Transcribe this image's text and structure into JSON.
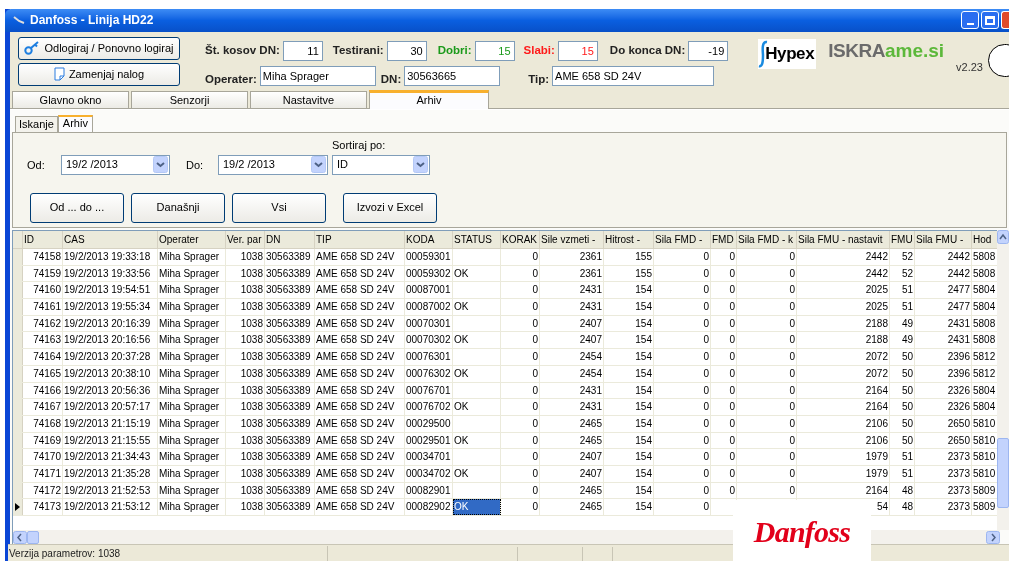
{
  "window": {
    "title": "Danfoss - Linija HD22"
  },
  "header": {
    "buttons": [
      {
        "label": "Odlogiraj / Ponovno logiraj"
      },
      {
        "label": "Zamenjaj nalog"
      }
    ],
    "counters": [
      {
        "label": "Št. kosov DN:",
        "value": "11",
        "kind": "plain"
      },
      {
        "label": "Testirani:",
        "value": "30",
        "kind": "plain"
      },
      {
        "label": "Dobri:",
        "value": "15",
        "kind": "good"
      },
      {
        "label": "Slabi:",
        "value": "15",
        "kind": "bad"
      },
      {
        "label": "Do konca DN:",
        "value": "-19",
        "kind": "plain"
      }
    ],
    "fields": [
      {
        "label": "Operater:",
        "value": "Miha Sprager"
      },
      {
        "label": "DN:",
        "value": "30563665"
      },
      {
        "label": "Tip:",
        "value": "AME 658 SD 24V"
      }
    ],
    "logos": {
      "hypex": "Hypex",
      "iskra": "ISKRA",
      "ame": "ame.si"
    },
    "version": "v2.23"
  },
  "tabs": [
    {
      "label": "Glavno okno",
      "selected": false
    },
    {
      "label": "Senzorji",
      "selected": false
    },
    {
      "label": "Nastavitve",
      "selected": false
    },
    {
      "label": "Arhiv",
      "selected": true
    }
  ],
  "subtabs": [
    {
      "label": "Iskanje",
      "selected": false
    },
    {
      "label": "Arhiv",
      "selected": true
    }
  ],
  "filters": {
    "from": {
      "label": "Od:",
      "value": "19/2 /2013"
    },
    "to": {
      "label": "Do:",
      "value": "19/2 /2013"
    },
    "sort": {
      "label": "Sortiraj po:",
      "value": "ID"
    }
  },
  "actions": [
    "Od ... do ...",
    "Današnji",
    "Vsi",
    "Izvozi v Excel"
  ],
  "table": {
    "columns": [
      "ID",
      "CAS",
      "Operater",
      "Ver. par",
      "DN",
      "TIP",
      "KODA",
      "STATUS",
      "KORAK",
      "Sile vzmeti -",
      "Hitrost -",
      "Sila FMD -",
      "FMD",
      "Sila FMD - k",
      "Sila FMU - nastavit",
      "FMU",
      "Sila FMU -",
      "Hod"
    ],
    "rows": [
      {
        "selected": false,
        "cells": [
          "74158",
          "19/2/2013 19:33:18",
          "Miha Sprager",
          "1038",
          "30563389",
          "AME 658 SD 24V",
          "00059301",
          null,
          "0",
          "2361",
          "155",
          "0",
          "0",
          "0",
          "2442",
          "52",
          "2442",
          "5808"
        ]
      },
      {
        "selected": false,
        "cells": [
          "74159",
          "19/2/2013 19:33:56",
          "Miha Sprager",
          "1038",
          "30563389",
          "AME 658 SD 24V",
          "00059302",
          "OK",
          "0",
          "2361",
          "155",
          "0",
          "0",
          "0",
          "2442",
          "52",
          "2442",
          "5808"
        ]
      },
      {
        "selected": false,
        "cells": [
          "74160",
          "19/2/2013 19:54:51",
          "Miha Sprager",
          "1038",
          "30563389",
          "AME 658 SD 24V",
          "00087001",
          null,
          "0",
          "2431",
          "154",
          "0",
          "0",
          "0",
          "2025",
          "51",
          "2477",
          "5804"
        ]
      },
      {
        "selected": false,
        "cells": [
          "74161",
          "19/2/2013 19:55:34",
          "Miha Sprager",
          "1038",
          "30563389",
          "AME 658 SD 24V",
          "00087002",
          "OK",
          "0",
          "2431",
          "154",
          "0",
          "0",
          "0",
          "2025",
          "51",
          "2477",
          "5804"
        ]
      },
      {
        "selected": false,
        "cells": [
          "74162",
          "19/2/2013 20:16:39",
          "Miha Sprager",
          "1038",
          "30563389",
          "AME 658 SD 24V",
          "00070301",
          null,
          "0",
          "2407",
          "154",
          "0",
          "0",
          "0",
          "2188",
          "49",
          "2431",
          "5808"
        ]
      },
      {
        "selected": false,
        "cells": [
          "74163",
          "19/2/2013 20:16:56",
          "Miha Sprager",
          "1038",
          "30563389",
          "AME 658 SD 24V",
          "00070302",
          "OK",
          "0",
          "2407",
          "154",
          "0",
          "0",
          "0",
          "2188",
          "49",
          "2431",
          "5808"
        ]
      },
      {
        "selected": false,
        "cells": [
          "74164",
          "19/2/2013 20:37:28",
          "Miha Sprager",
          "1038",
          "30563389",
          "AME 658 SD 24V",
          "00076301",
          null,
          "0",
          "2454",
          "154",
          "0",
          "0",
          "0",
          "2072",
          "50",
          "2396",
          "5812"
        ]
      },
      {
        "selected": false,
        "cells": [
          "74165",
          "19/2/2013 20:38:10",
          "Miha Sprager",
          "1038",
          "30563389",
          "AME 658 SD 24V",
          "00076302",
          "OK",
          "0",
          "2454",
          "154",
          "0",
          "0",
          "0",
          "2072",
          "50",
          "2396",
          "5812"
        ]
      },
      {
        "selected": false,
        "cells": [
          "74166",
          "19/2/2013 20:56:36",
          "Miha Sprager",
          "1038",
          "30563389",
          "AME 658 SD 24V",
          "00076701",
          null,
          "0",
          "2431",
          "154",
          "0",
          "0",
          "0",
          "2164",
          "50",
          "2326",
          "5804"
        ]
      },
      {
        "selected": false,
        "cells": [
          "74167",
          "19/2/2013 20:57:17",
          "Miha Sprager",
          "1038",
          "30563389",
          "AME 658 SD 24V",
          "00076702",
          "OK",
          "0",
          "2431",
          "154",
          "0",
          "0",
          "0",
          "2164",
          "50",
          "2326",
          "5804"
        ]
      },
      {
        "selected": false,
        "cells": [
          "74168",
          "19/2/2013 21:15:19",
          "Miha Sprager",
          "1038",
          "30563389",
          "AME 658 SD 24V",
          "00029500",
          null,
          "0",
          "2465",
          "154",
          "0",
          "0",
          "0",
          "2106",
          "50",
          "2650",
          "5810"
        ]
      },
      {
        "selected": false,
        "cells": [
          "74169",
          "19/2/2013 21:15:55",
          "Miha Sprager",
          "1038",
          "30563389",
          "AME 658 SD 24V",
          "00029501",
          "OK",
          "0",
          "2465",
          "154",
          "0",
          "0",
          "0",
          "2106",
          "50",
          "2650",
          "5810"
        ]
      },
      {
        "selected": false,
        "cells": [
          "74170",
          "19/2/2013 21:34:43",
          "Miha Sprager",
          "1038",
          "30563389",
          "AME 658 SD 24V",
          "00034701",
          null,
          "0",
          "2407",
          "154",
          "0",
          "0",
          "0",
          "1979",
          "51",
          "2373",
          "5810"
        ]
      },
      {
        "selected": false,
        "cells": [
          "74171",
          "19/2/2013 21:35:28",
          "Miha Sprager",
          "1038",
          "30563389",
          "AME 658 SD 24V",
          "00034702",
          "OK",
          "0",
          "2407",
          "154",
          "0",
          "0",
          "0",
          "1979",
          "51",
          "2373",
          "5810"
        ]
      },
      {
        "selected": false,
        "cells": [
          "74172",
          "19/2/2013 21:52:53",
          "Miha Sprager",
          "1038",
          "30563389",
          "AME 658 SD 24V",
          "00082901",
          null,
          "0",
          "2465",
          "154",
          "0",
          "0",
          "0",
          "2164",
          "48",
          "2373",
          "5809"
        ]
      },
      {
        "selected": true,
        "cells": [
          "74173",
          "19/2/2013 21:53:12",
          "Miha Sprager",
          "1038",
          "30563389",
          "AME 658 SD 24V",
          "00082902",
          "OK",
          "0",
          "2465",
          "154",
          "0",
          null,
          null,
          "54",
          "48",
          "2373",
          "5809"
        ]
      }
    ]
  },
  "overlay_logo": "Danfoss",
  "status_bar": "Verzija parametrov: 1038"
}
